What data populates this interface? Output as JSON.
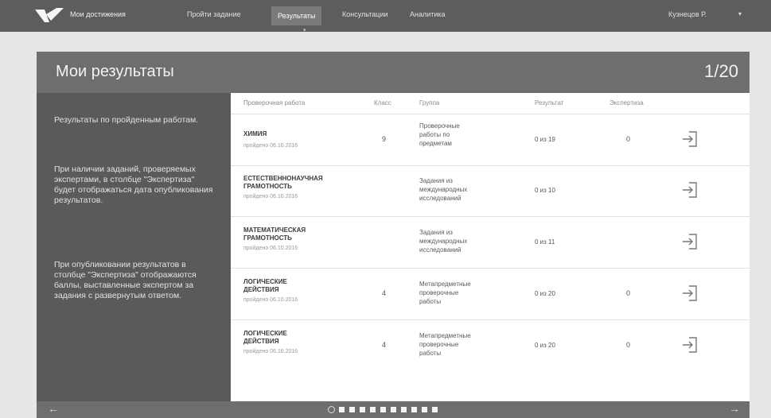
{
  "nav": {
    "brand": "Мои достижения",
    "items": [
      "Пройти задание",
      "Результаты",
      "Консультации",
      "Аналитика"
    ],
    "user": "Кузнецов Р.",
    "user_caret": "▾",
    "active_caret": "▾"
  },
  "panel": {
    "title": "Мои результаты",
    "counter": "1/20"
  },
  "sidebar": {
    "paragraphs": [
      "Результаты по пройденным работам.",
      "При наличии заданий, проверяемых экспертами, в столбце \"Экспертиза\" будет отображаться дата опубликования результатов.",
      "При опубликовании результатов в столбце \"Экспертиза\" отображаются баллы, выставленные экспертом за задания с развернутым ответом."
    ]
  },
  "table": {
    "headers": [
      "Проверочная работа",
      "Класс",
      "Группа",
      "Результат",
      "Экспертиза"
    ],
    "rows": [
      {
        "name_lines": [
          "ХИМИЯ"
        ],
        "date": "пройдено 06.10.2016",
        "class": "9",
        "group_lines": [
          "Проверочные",
          "работы по",
          "предметам"
        ],
        "result": "0 из 19",
        "expertise": "0"
      },
      {
        "name_lines": [
          "ЕСТЕСТВЕННОНАУЧНАЯ",
          "ГРАМОТНОСТЬ"
        ],
        "date": "пройдено 06.10.2016",
        "class": "",
        "group_lines": [
          "Задания из",
          "международных",
          "исследований"
        ],
        "result": "0 из 10",
        "expertise": ""
      },
      {
        "name_lines": [
          "МАТЕМАТИЧЕСКАЯ",
          "ГРАМОТНОСТЬ"
        ],
        "date": "пройдено 06.10.2016",
        "class": "",
        "group_lines": [
          "Задания из",
          "международных",
          "исследований"
        ],
        "result": "0 из 11",
        "expertise": ""
      },
      {
        "name_lines": [
          "ЛОГИЧЕСКИЕ",
          "ДЕЙСТВИЯ"
        ],
        "date": "пройдено 06.10.2016",
        "class": "4",
        "group_lines": [
          "Метапредметные",
          "проверочные",
          "работы"
        ],
        "result": "0 из 20",
        "expertise": "0"
      },
      {
        "name_lines": [
          "ЛОГИЧЕСКИЕ",
          "ДЕЙСТВИЯ"
        ],
        "date": "пройдено 06.10.2016",
        "class": "4",
        "group_lines": [
          "Метапредметные",
          "проверочные",
          "работы"
        ],
        "result": "0 из 20",
        "expertise": "0"
      }
    ]
  },
  "footer": {
    "prev": "←",
    "next": "→",
    "page_dots_filled": 10,
    "page_dot_current": "open-circle"
  },
  "colors": {
    "topbar": "#5d5d5d",
    "panel_header": "#6e6e6e",
    "sidebar": "#5a5a5a",
    "background": "#e6e6e6"
  },
  "icons": [
    "logo-icon",
    "open-result-icon",
    "arrow-left-icon",
    "arrow-right-icon"
  ]
}
